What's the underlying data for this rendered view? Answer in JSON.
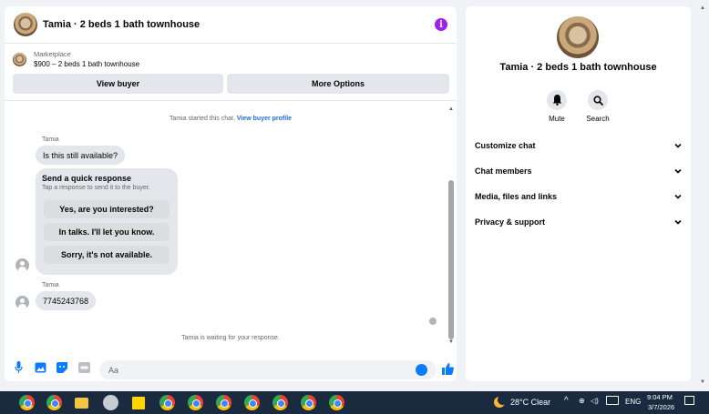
{
  "chat": {
    "title": "Tamia · 2 beds 1 bath townhouse",
    "listing": {
      "source": "Marketplace",
      "price": "$900 – 2 beds 1 bath townhouse"
    },
    "buttons": {
      "view_buyer": "View buyer",
      "more_options": "More Options"
    },
    "system_started": "Tamia started this chat.",
    "system_link": "View buyer profile",
    "messages": [
      {
        "sender": "Tamia",
        "text": "Is this still available?"
      },
      {
        "sender": "Tamia",
        "text": "7745243768"
      }
    ],
    "quick_response": {
      "title": "Send a quick response",
      "subtitle": "Tap a response to send it to the buyer.",
      "options": [
        "Yes, are you interested?",
        "In talks. I'll let you know.",
        "Sorry, it's not available."
      ]
    },
    "waiting_text": "Tamia is waiting for your response.",
    "composer_placeholder": "Aa"
  },
  "info_panel": {
    "title": "Tamia · 2 beds 1 bath townhouse",
    "actions": [
      {
        "label": "Mute",
        "icon": "bell-icon"
      },
      {
        "label": "Search",
        "icon": "search-icon"
      }
    ],
    "sections": [
      "Customize chat",
      "Chat members",
      "Media, files and links",
      "Privacy & support"
    ]
  },
  "taskbar": {
    "weather": "28°C  Clear",
    "language": "ENG",
    "time": "9:04 PM",
    "date": "3/7/2026"
  },
  "colors": {
    "accent": "#0a7cff",
    "info": "#a020f0",
    "link": "#216fdb"
  }
}
